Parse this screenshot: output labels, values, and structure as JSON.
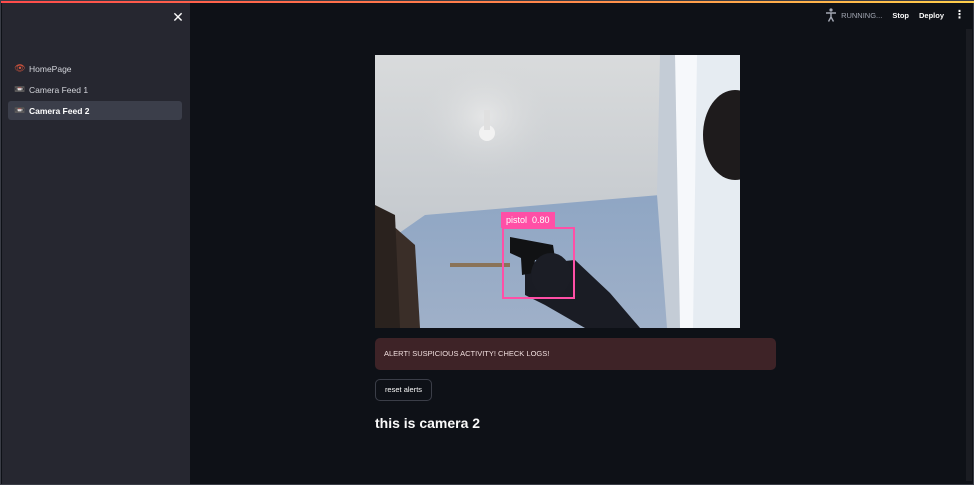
{
  "sidebar": {
    "close_glyph": "✕",
    "items": [
      {
        "label": "HomePage",
        "icon": "eye-icon",
        "glyph": "👁",
        "active": false
      },
      {
        "label": "Camera Feed 1",
        "icon": "camera-icon",
        "glyph": "📼",
        "active": false
      },
      {
        "label": "Camera Feed 2",
        "icon": "camera-icon",
        "glyph": "📼",
        "active": true
      }
    ]
  },
  "header": {
    "status": "RUNNING...",
    "stop_label": "Stop",
    "deploy_label": "Deploy",
    "menu_glyph": "⋮"
  },
  "main": {
    "detection": {
      "label": "pistol",
      "confidence": "0.80"
    },
    "alert_text": "ALERT! SUSPICIOUS ACTIVITY! CHECK LOGS!",
    "reset_label": "reset alerts",
    "heading": "this is camera 2"
  },
  "colors": {
    "background": "#0e1117",
    "sidebar": "#262730",
    "alert_bg": "#3e2327",
    "detection_box": "#ff4fa6",
    "accent": "#ff4b4b"
  }
}
